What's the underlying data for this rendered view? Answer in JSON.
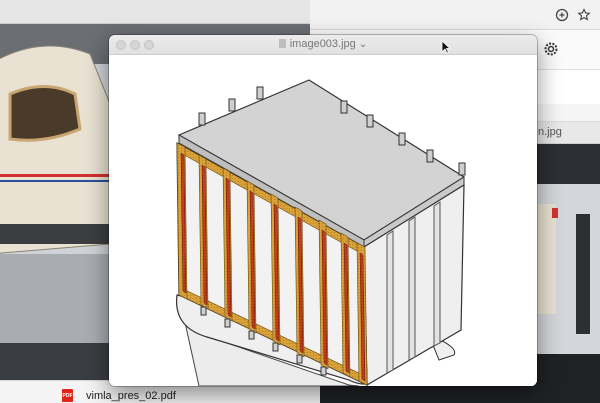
{
  "background_right": {
    "partial_filename": "n.jpg"
  },
  "file_strip": {
    "file_name": "vimla_pres_02.pdf",
    "file_type_badge": "PDF"
  },
  "preview_window": {
    "title": "image003.jpg",
    "title_chevron": "⌄"
  },
  "colors": {
    "frame_orange": "#d49a2a",
    "frame_red": "#c2371c",
    "box_panel": "#f0f0f0",
    "box_top": "#d3d3d3"
  }
}
